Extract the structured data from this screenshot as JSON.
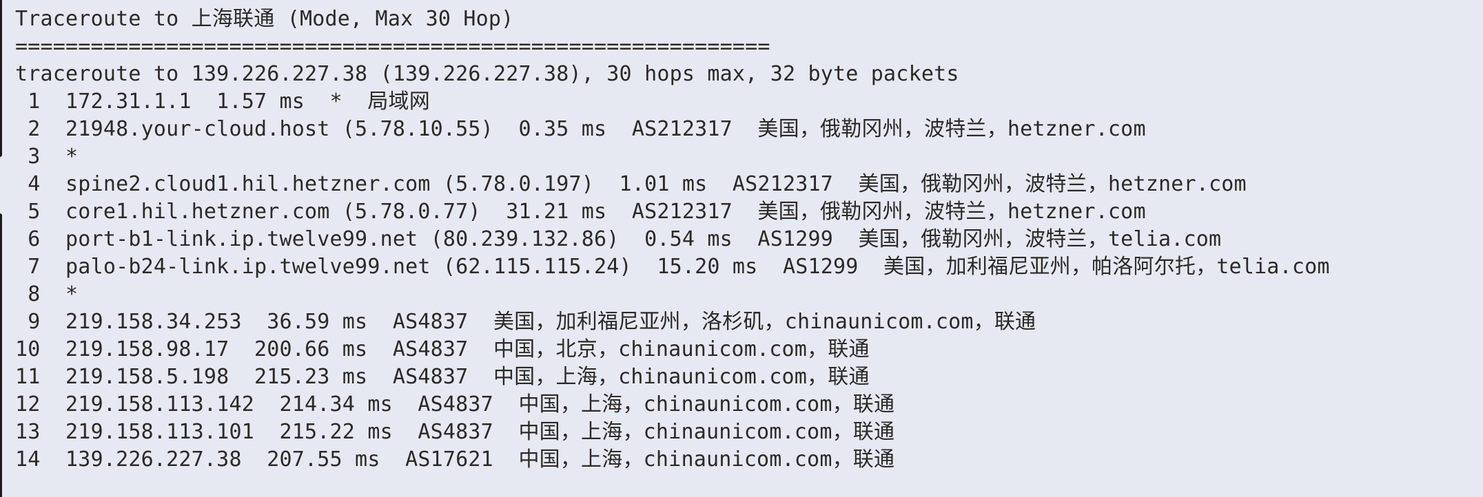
{
  "terminal": {
    "title_line": "Traceroute to 上海联通 (Mode, Max 30 Hop)",
    "separator_line": "============================================================",
    "header_line": "traceroute to 139.226.227.38 (139.226.227.38), 30 hops max, 32 byte packets",
    "hops": [
      " 1  172.31.1.1  1.57 ms  *  局域网",
      " 2  21948.your-cloud.host (5.78.10.55)  0.35 ms  AS212317  美国，俄勒冈州，波特兰，hetzner.com",
      " 3  *",
      " 4  spine2.cloud1.hil.hetzner.com (5.78.0.197)  1.01 ms  AS212317  美国，俄勒冈州，波特兰，hetzner.com",
      " 5  core1.hil.hetzner.com (5.78.0.77)  31.21 ms  AS212317  美国，俄勒冈州，波特兰，hetzner.com",
      " 6  port-b1-link.ip.twelve99.net (80.239.132.86)  0.54 ms  AS1299  美国，俄勒冈州，波特兰，telia.com",
      " 7  palo-b24-link.ip.twelve99.net (62.115.115.24)  15.20 ms  AS1299  美国，加利福尼亚州，帕洛阿尔托，telia.com",
      " 8  *",
      " 9  219.158.34.253  36.59 ms  AS4837  美国，加利福尼亚州，洛杉矶，chinaunicom.com，联通",
      "10  219.158.98.17  200.66 ms  AS4837  中国，北京，chinaunicom.com，联通",
      "11  219.158.5.198  215.23 ms  AS4837  中国，上海，chinaunicom.com，联通",
      "12  219.158.113.142  214.34 ms  AS4837  中国，上海，chinaunicom.com，联通",
      "13  219.158.113.101  215.22 ms  AS4837  中国，上海，chinaunicom.com，联通",
      "14  139.226.227.38  207.55 ms  AS17621  中国，上海，chinaunicom.com，联通"
    ]
  }
}
